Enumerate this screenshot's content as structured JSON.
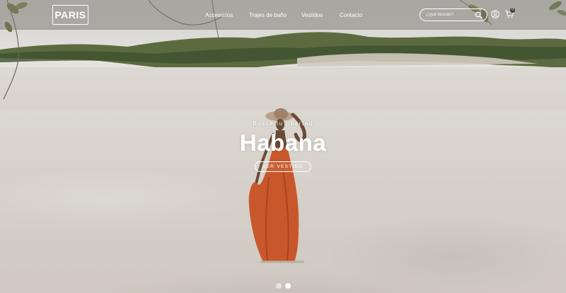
{
  "brand": {
    "logo_text": "PARIS"
  },
  "nav": {
    "links": [
      {
        "label": "Accesorios"
      },
      {
        "label": "Trajes de baño"
      },
      {
        "label": "Vestidos"
      },
      {
        "label": "Contacto"
      }
    ]
  },
  "search": {
    "placeholder": "¿Qué buscás?",
    "icon": "search-icon"
  },
  "account": {
    "icon": "user-icon"
  },
  "cart": {
    "icon": "cart-icon",
    "count": "0"
  },
  "hero": {
    "eyebrow": "Busca tu libertad",
    "title": "Habana",
    "cta_label": "VER VESTIDO"
  },
  "slider": {
    "total_slides": 2,
    "active_index": 1
  },
  "colors": {
    "dress": "#c8582c",
    "navbar_overlay": "#78766f",
    "text": "#ffffff"
  }
}
